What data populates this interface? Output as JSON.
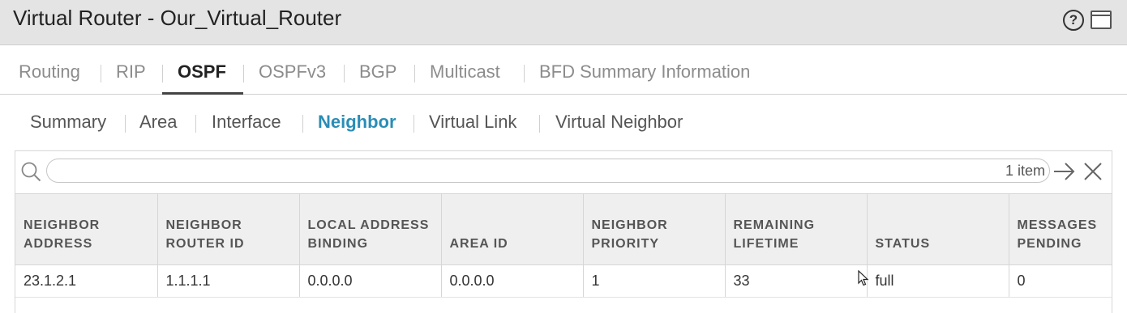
{
  "window": {
    "title": "Virtual Router - Our_Virtual_Router"
  },
  "top_tabs": [
    "Routing",
    "RIP",
    "OSPF",
    "OSPFv3",
    "BGP",
    "Multicast",
    "BFD Summary Information"
  ],
  "top_tabs_active": "OSPF",
  "sub_tabs": [
    "Summary",
    "Area",
    "Interface",
    "Neighbor",
    "Virtual Link",
    "Virtual Neighbor"
  ],
  "sub_tabs_active": "Neighbor",
  "search": {
    "value": "",
    "placeholder": "",
    "count": "1 item"
  },
  "table": {
    "columns": [
      "NEIGHBOR\nADDRESS",
      "NEIGHBOR\nROUTER ID",
      "LOCAL ADDRESS\nBINDING",
      "AREA ID",
      "NEIGHBOR\nPRIORITY",
      "REMAINING\nLIFETIME",
      "STATUS",
      "MESSAGES\nPENDING"
    ],
    "rows": [
      [
        "23.1.2.1",
        "1.1.1.1",
        "0.0.0.0",
        "0.0.0.0",
        "1",
        "33",
        "full",
        "0"
      ]
    ]
  },
  "icons": {
    "help": "help-icon",
    "window": "window-icon",
    "search": "search-icon",
    "go": "arrow-right-icon",
    "clear": "close-icon"
  },
  "colors": {
    "active_subtab": "#2a8db6",
    "titlebar_bg": "#e4e4e4",
    "header_bg": "#efefef"
  }
}
